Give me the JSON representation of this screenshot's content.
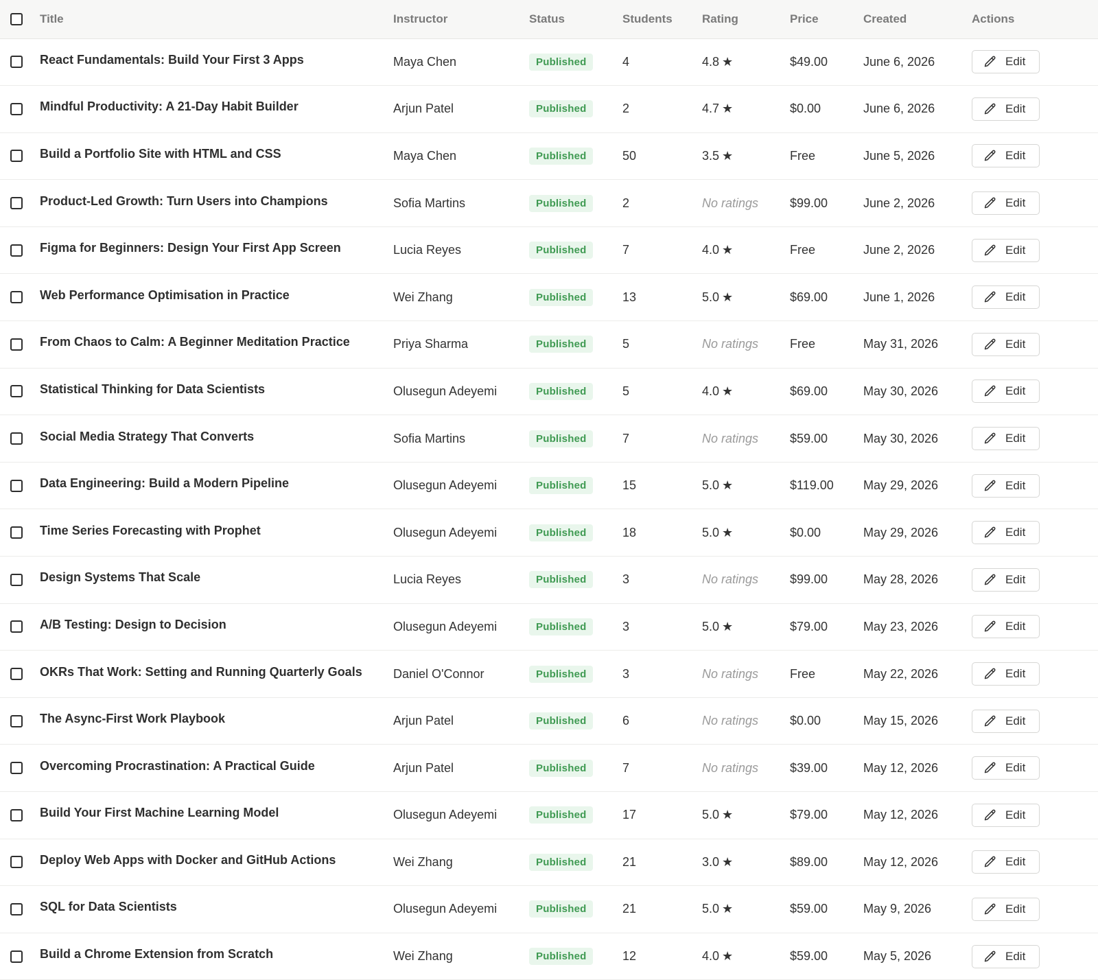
{
  "table": {
    "columns": {
      "title": "Title",
      "instructor": "Instructor",
      "status": "Status",
      "students": "Students",
      "rating": "Rating",
      "price": "Price",
      "created": "Created",
      "actions": "Actions"
    },
    "edit_label": "Edit",
    "star": "★",
    "rows": [
      {
        "title": "React Fundamentals: Build Your First 3 Apps",
        "instructor": "Maya Chen",
        "status": "Published",
        "students": "4",
        "rating": "4.8",
        "has_rating": true,
        "price": "$49.00",
        "created": "June 6, 2026"
      },
      {
        "title": "Mindful Productivity: A 21-Day Habit Builder",
        "instructor": "Arjun Patel",
        "status": "Published",
        "students": "2",
        "rating": "4.7",
        "has_rating": true,
        "price": "$0.00",
        "created": "June 6, 2026"
      },
      {
        "title": "Build a Portfolio Site with HTML and CSS",
        "instructor": "Maya Chen",
        "status": "Published",
        "students": "50",
        "rating": "3.5",
        "has_rating": true,
        "price": "Free",
        "created": "June 5, 2026"
      },
      {
        "title": "Product-Led Growth: Turn Users into Champions",
        "instructor": "Sofia Martins",
        "status": "Published",
        "students": "2",
        "rating": "No ratings",
        "has_rating": false,
        "price": "$99.00",
        "created": "June 2, 2026"
      },
      {
        "title": "Figma for Beginners: Design Your First App Screen",
        "instructor": "Lucia Reyes",
        "status": "Published",
        "students": "7",
        "rating": "4.0",
        "has_rating": true,
        "price": "Free",
        "created": "June 2, 2026"
      },
      {
        "title": "Web Performance Optimisation in Practice",
        "instructor": "Wei Zhang",
        "status": "Published",
        "students": "13",
        "rating": "5.0",
        "has_rating": true,
        "price": "$69.00",
        "created": "June 1, 2026"
      },
      {
        "title": "From Chaos to Calm: A Beginner Meditation Practice",
        "instructor": "Priya Sharma",
        "status": "Published",
        "students": "5",
        "rating": "No ratings",
        "has_rating": false,
        "price": "Free",
        "created": "May 31, 2026"
      },
      {
        "title": "Statistical Thinking for Data Scientists",
        "instructor": "Olusegun Adeyemi",
        "status": "Published",
        "students": "5",
        "rating": "4.0",
        "has_rating": true,
        "price": "$69.00",
        "created": "May 30, 2026"
      },
      {
        "title": "Social Media Strategy That Converts",
        "instructor": "Sofia Martins",
        "status": "Published",
        "students": "7",
        "rating": "No ratings",
        "has_rating": false,
        "price": "$59.00",
        "created": "May 30, 2026"
      },
      {
        "title": "Data Engineering: Build a Modern Pipeline",
        "instructor": "Olusegun Adeyemi",
        "status": "Published",
        "students": "15",
        "rating": "5.0",
        "has_rating": true,
        "price": "$119.00",
        "created": "May 29, 2026"
      },
      {
        "title": "Time Series Forecasting with Prophet",
        "instructor": "Olusegun Adeyemi",
        "status": "Published",
        "students": "18",
        "rating": "5.0",
        "has_rating": true,
        "price": "$0.00",
        "created": "May 29, 2026"
      },
      {
        "title": "Design Systems That Scale",
        "instructor": "Lucia Reyes",
        "status": "Published",
        "students": "3",
        "rating": "No ratings",
        "has_rating": false,
        "price": "$99.00",
        "created": "May 28, 2026"
      },
      {
        "title": "A/B Testing: Design to Decision",
        "instructor": "Olusegun Adeyemi",
        "status": "Published",
        "students": "3",
        "rating": "5.0",
        "has_rating": true,
        "price": "$79.00",
        "created": "May 23, 2026"
      },
      {
        "title": "OKRs That Work: Setting and Running Quarterly Goals",
        "instructor": "Daniel O'Connor",
        "status": "Published",
        "students": "3",
        "rating": "No ratings",
        "has_rating": false,
        "price": "Free",
        "created": "May 22, 2026"
      },
      {
        "title": "The Async-First Work Playbook",
        "instructor": "Arjun Patel",
        "status": "Published",
        "students": "6",
        "rating": "No ratings",
        "has_rating": false,
        "price": "$0.00",
        "created": "May 15, 2026"
      },
      {
        "title": "Overcoming Procrastination: A Practical Guide",
        "instructor": "Arjun Patel",
        "status": "Published",
        "students": "7",
        "rating": "No ratings",
        "has_rating": false,
        "price": "$39.00",
        "created": "May 12, 2026"
      },
      {
        "title": "Build Your First Machine Learning Model",
        "instructor": "Olusegun Adeyemi",
        "status": "Published",
        "students": "17",
        "rating": "5.0",
        "has_rating": true,
        "price": "$79.00",
        "created": "May 12, 2026"
      },
      {
        "title": "Deploy Web Apps with Docker and GitHub Actions",
        "instructor": "Wei Zhang",
        "status": "Published",
        "students": "21",
        "rating": "3.0",
        "has_rating": true,
        "price": "$89.00",
        "created": "May 12, 2026"
      },
      {
        "title": "SQL for Data Scientists",
        "instructor": "Olusegun Adeyemi",
        "status": "Published",
        "students": "21",
        "rating": "5.0",
        "has_rating": true,
        "price": "$59.00",
        "created": "May 9, 2026"
      },
      {
        "title": "Build a Chrome Extension from Scratch",
        "instructor": "Wei Zhang",
        "status": "Published",
        "students": "12",
        "rating": "4.0",
        "has_rating": true,
        "price": "$59.00",
        "created": "May 5, 2026"
      }
    ]
  },
  "colors": {
    "header_bg": "#f7f7f6",
    "badge_bg": "#e9f6ec",
    "badge_text": "#3f9a52",
    "muted": "#9a9a9a"
  },
  "icons": {
    "edit": "pencil-icon",
    "rating": "star-icon"
  }
}
